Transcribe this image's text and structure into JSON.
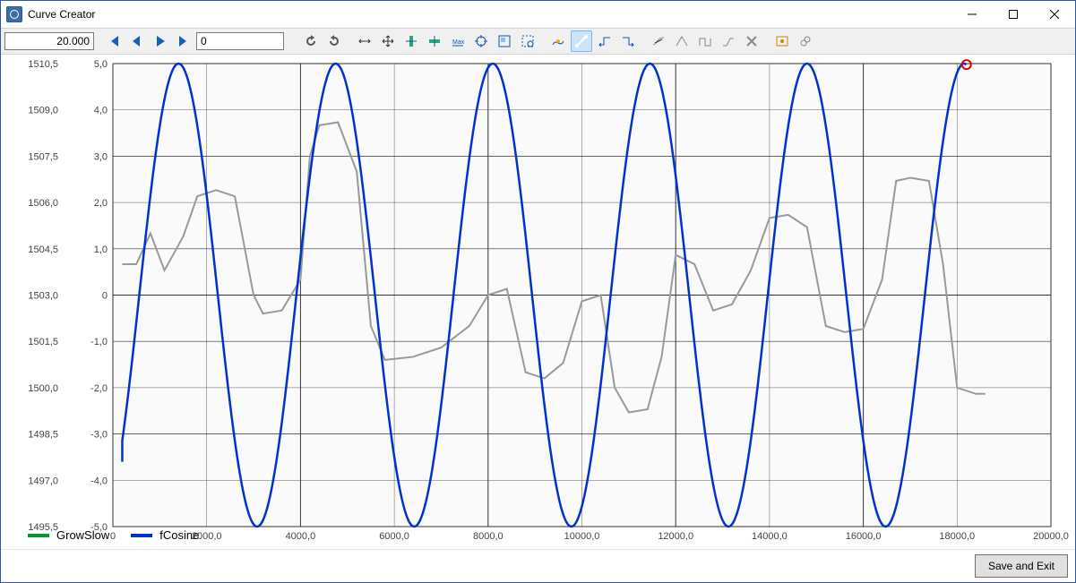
{
  "window": {
    "title": "Curve Creator"
  },
  "toolbar": {
    "time_value": "20.000",
    "slider_value": "0",
    "icons": [
      "first",
      "prev",
      "play",
      "last",
      "refresh",
      "undo",
      "move-h",
      "move-free",
      "zoom-y",
      "zoom-x",
      "zoom-fit",
      "target",
      "zoom-window",
      "zoom-region",
      "edit-curve",
      "line-tool",
      "step-prev",
      "step-next",
      "tangent",
      "peak",
      "square",
      "ramp",
      "delete",
      "settings",
      "link"
    ],
    "active_tool": "line-tool"
  },
  "buttons": {
    "save_exit": "Save and Exit"
  },
  "legend": [
    {
      "label": "GrowSlow",
      "color": "#009933"
    },
    {
      "label": "fCosine",
      "color": "#0033cc"
    }
  ],
  "chart_data": {
    "type": "line",
    "xlim": [
      0,
      20000
    ],
    "ylim_left": [
      1495.5,
      1510.5
    ],
    "ylim_right": [
      -5,
      5
    ],
    "x_ticks": [
      0,
      2000,
      4000,
      6000,
      8000,
      10000,
      12000,
      14000,
      16000,
      18000,
      20000
    ],
    "x_tick_labels": [
      "0",
      "2000,0",
      "4000,0",
      "6000,0",
      "8000,0",
      "10000,0",
      "12000,0",
      "14000,0",
      "16000,0",
      "18000,0",
      "20000,0"
    ],
    "y_left_ticks": [
      1495.5,
      1497.0,
      1498.5,
      1500.0,
      1501.5,
      1503.0,
      1504.5,
      1506.0,
      1507.5,
      1509.0,
      1510.5
    ],
    "y_left_labels": [
      "1495,5",
      "1497,0",
      "1498,5",
      "1500,0",
      "1501,5",
      "1503,0",
      "1504,5",
      "1506,0",
      "1507,5",
      "1509,0",
      "1510,5"
    ],
    "y_right_ticks": [
      -5,
      -4,
      -3,
      -2,
      -1,
      0,
      1,
      2,
      3,
      4,
      5
    ],
    "y_right_labels": [
      "-5,0",
      "-4,0",
      "-3,0",
      "-2,0",
      "-1,0",
      "0",
      "1,0",
      "2,0",
      "3,0",
      "4,0",
      "5,0"
    ],
    "series": [
      {
        "name": "fCosine",
        "color": "#0033cc",
        "axis": "right",
        "fn": "cosine",
        "amplitude": 5,
        "period": 3350,
        "phase": 1400,
        "x_start": 200,
        "x_end": 18200,
        "marker_end": {
          "x": 18200,
          "color": "#e60000"
        }
      },
      {
        "name": "GrowSlow",
        "color": "#999999",
        "axis": "left",
        "points": [
          [
            200,
            1504.0
          ],
          [
            500,
            1504.0
          ],
          [
            800,
            1505.0
          ],
          [
            1100,
            1503.8
          ],
          [
            1500,
            1504.9
          ],
          [
            1800,
            1506.2
          ],
          [
            2200,
            1506.4
          ],
          [
            2600,
            1506.2
          ],
          [
            3000,
            1503.0
          ],
          [
            3200,
            1502.4
          ],
          [
            3600,
            1502.5
          ],
          [
            4000,
            1503.5
          ],
          [
            4200,
            1507.5
          ],
          [
            4400,
            1508.5
          ],
          [
            4800,
            1508.6
          ],
          [
            5200,
            1507.0
          ],
          [
            5500,
            1502.0
          ],
          [
            5800,
            1500.9
          ],
          [
            6400,
            1501.0
          ],
          [
            7000,
            1501.3
          ],
          [
            7600,
            1502.0
          ],
          [
            8000,
            1503.0
          ],
          [
            8400,
            1503.2
          ],
          [
            8800,
            1500.5
          ],
          [
            9200,
            1500.3
          ],
          [
            9600,
            1500.8
          ],
          [
            10000,
            1502.8
          ],
          [
            10400,
            1503.0
          ],
          [
            10700,
            1500.0
          ],
          [
            11000,
            1499.2
          ],
          [
            11400,
            1499.3
          ],
          [
            11700,
            1501.0
          ],
          [
            12000,
            1504.3
          ],
          [
            12400,
            1504.0
          ],
          [
            12800,
            1502.5
          ],
          [
            13200,
            1502.7
          ],
          [
            13600,
            1503.8
          ],
          [
            14000,
            1505.5
          ],
          [
            14400,
            1505.6
          ],
          [
            14800,
            1505.2
          ],
          [
            15200,
            1502.0
          ],
          [
            15600,
            1501.8
          ],
          [
            16000,
            1501.9
          ],
          [
            16400,
            1503.5
          ],
          [
            16700,
            1506.7
          ],
          [
            17000,
            1506.8
          ],
          [
            17400,
            1506.7
          ],
          [
            17700,
            1504.0
          ],
          [
            18000,
            1500.0
          ],
          [
            18400,
            1499.8
          ],
          [
            18600,
            1499.8
          ]
        ]
      }
    ]
  }
}
